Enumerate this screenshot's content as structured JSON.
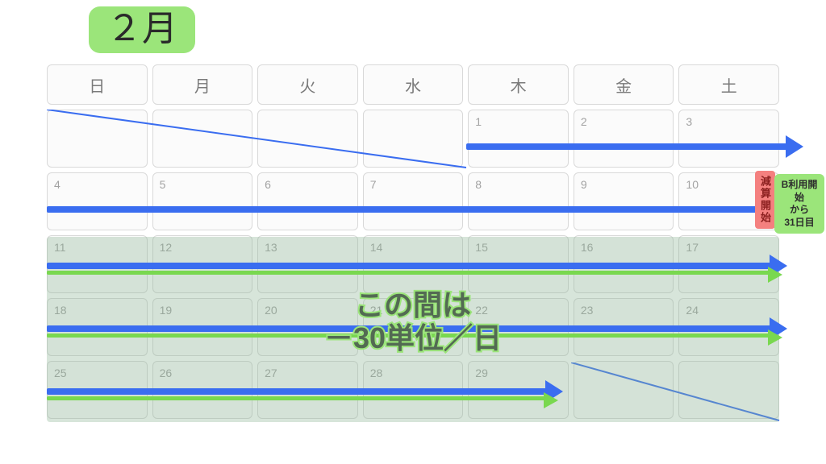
{
  "month_label": "２月",
  "dow": [
    "日",
    "月",
    "火",
    "水",
    "木",
    "金",
    "土"
  ],
  "weeks": [
    [
      "",
      "",
      "",
      "",
      "1",
      "2",
      "3"
    ],
    [
      "4",
      "5",
      "6",
      "7",
      "8",
      "9",
      "10"
    ],
    [
      "11",
      "12",
      "13",
      "14",
      "15",
      "16",
      "17"
    ],
    [
      "18",
      "19",
      "20",
      "21",
      "22",
      "23",
      "24"
    ],
    [
      "25",
      "26",
      "27",
      "28",
      "29",
      "",
      ""
    ]
  ],
  "overlay": {
    "line1": "この間は",
    "line2": "－30単位／日"
  },
  "red_label": "減算開始",
  "side_badge": {
    "l1": "B利用開始",
    "l2": "から",
    "l3": "31日目"
  },
  "colors": {
    "blue": "#3a6df0",
    "green": "#79d84f",
    "badge": "#9be57a",
    "red": "#f4807f"
  }
}
